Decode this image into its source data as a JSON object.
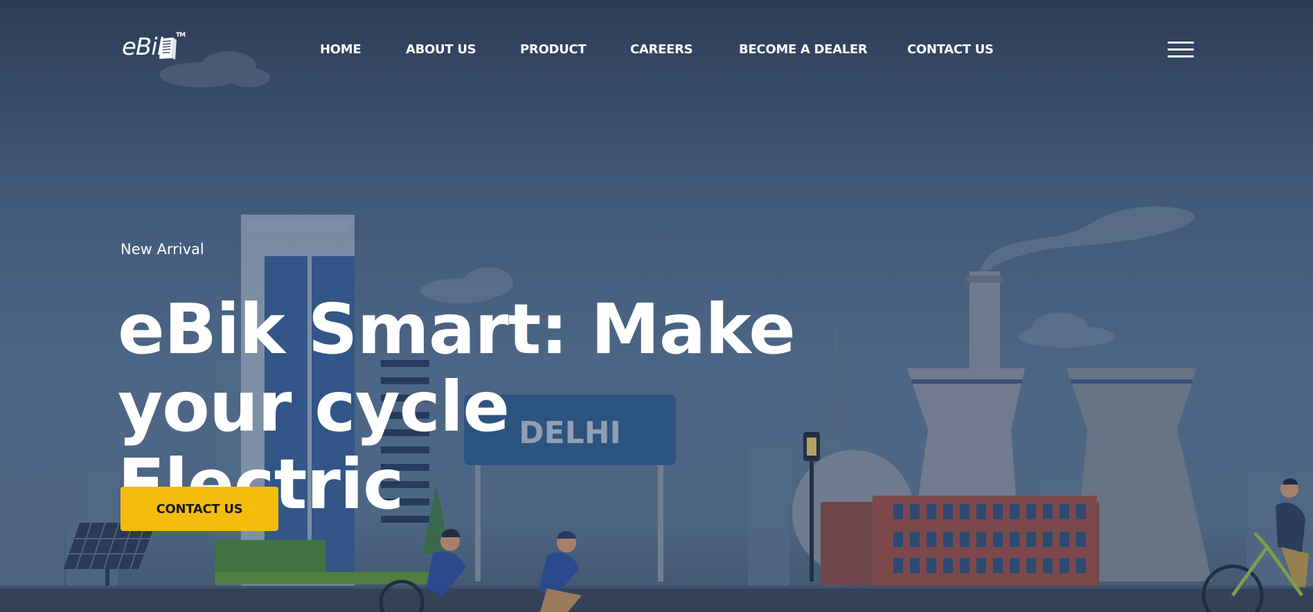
{
  "brand": {
    "name": "eBik",
    "tm": "TM"
  },
  "nav": {
    "items": [
      {
        "label": "HOME"
      },
      {
        "label": "ABOUT US"
      },
      {
        "label": "PRODUCT"
      },
      {
        "label": "CAREERS"
      },
      {
        "label": "BECOME A DEALER"
      },
      {
        "label": "CONTACT US"
      }
    ],
    "menu_icon": "hamburger-icon"
  },
  "hero": {
    "eyebrow": "New Arrival",
    "headline_line1": "eBik Smart: Make",
    "headline_line2": "your cycle Electric",
    "cta_label": "CONTACT US",
    "sign_text": "DELHI"
  },
  "colors": {
    "accent": "#f4bd0b",
    "text": "#ffffff",
    "sky_top": "#2d3d57",
    "sky_mid": "#5b7898"
  }
}
